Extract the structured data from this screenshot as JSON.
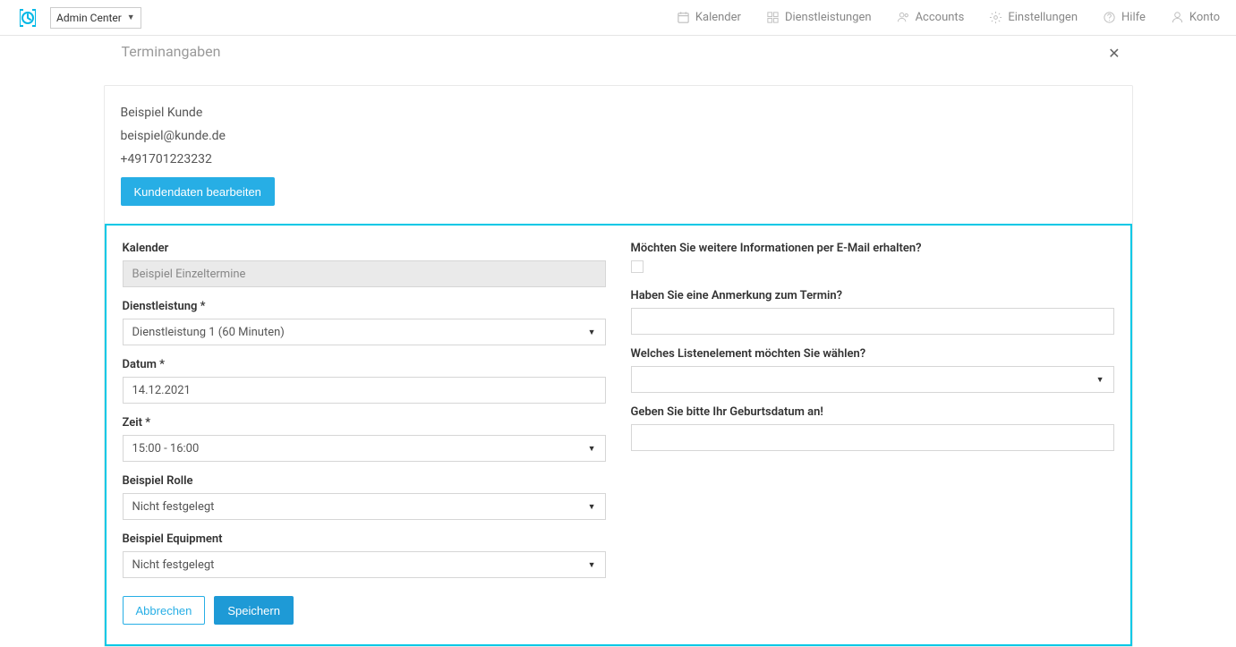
{
  "topbar": {
    "admin_center_label": "Admin Center",
    "nav": {
      "kalender": "Kalender",
      "dienstleistungen": "Dienstleistungen",
      "accounts": "Accounts",
      "einstellungen": "Einstellungen",
      "hilfe": "Hilfe",
      "konto": "Konto"
    }
  },
  "sheet": {
    "title": "Terminangaben"
  },
  "customer": {
    "name": "Beispiel Kunde",
    "email": "beispiel@kunde.de",
    "phone": "+491701223232",
    "edit_label": "Kundendaten bearbeiten"
  },
  "form": {
    "left": {
      "kalender_label": "Kalender",
      "kalender_value": "Beispiel Einzeltermine",
      "dienstleistung_label": "Dienstleistung *",
      "dienstleistung_value": "Dienstleistung 1 (60 Minuten)",
      "datum_label": "Datum *",
      "datum_value": "14.12.2021",
      "zeit_label": "Zeit *",
      "zeit_value": "15:00 - 16:00",
      "rolle_label": "Beispiel Rolle",
      "rolle_value": "Nicht festgelegt",
      "equipment_label": "Beispiel Equipment",
      "equipment_value": "Nicht festgelegt"
    },
    "right": {
      "more_info_label": "Möchten Sie weitere Informationen per E-Mail erhalten?",
      "anmerkung_label": "Haben Sie eine Anmerkung zum Termin?",
      "anmerkung_value": "",
      "liste_label": "Welches Listenelement möchten Sie wählen?",
      "liste_value": "",
      "geburtsdatum_label": "Geben Sie bitte Ihr Geburtsdatum an!",
      "geburtsdatum_value": ""
    },
    "actions": {
      "cancel_label": "Abbrechen",
      "save_label": "Speichern"
    }
  }
}
